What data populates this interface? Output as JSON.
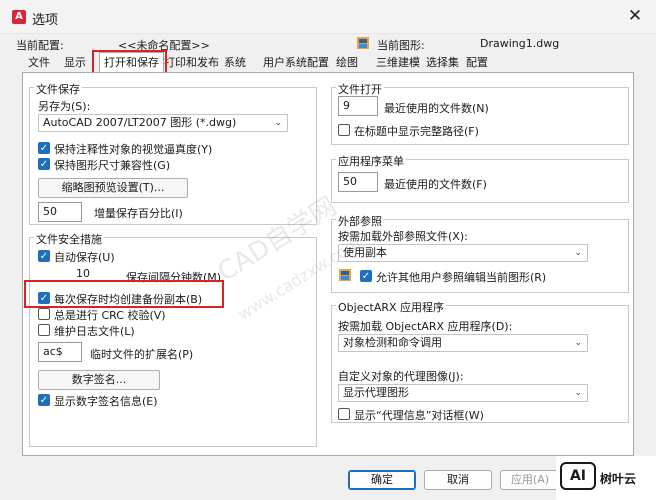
{
  "window": {
    "title": "选项",
    "app_icon_letter": "A",
    "close_glyph": "✕"
  },
  "profile": {
    "current_profile_label": "当前配置:",
    "current_profile_value": "<<未命名配置>>",
    "current_drawing_label": "当前图形:",
    "current_drawing_value": "Drawing1.dwg"
  },
  "tabs": [
    "文件",
    "显示",
    "打开和保存",
    "打印和发布",
    "系统",
    "用户系统配置",
    "绘图",
    "三维建模",
    "选择集",
    "配置"
  ],
  "active_tab": "打开和保存",
  "file_save": {
    "title": "文件保存",
    "save_as_label": "另存为(S):",
    "save_as_value": "AutoCAD 2007/LT2007 图形 (*.dwg)",
    "keep_visual_fidelity": "保持注释性对象的视觉逼真度(Y)",
    "keep_drawing_size": "保持图形尺寸兼容性(G)",
    "thumbnail_button": "缩略图预览设置(T)...",
    "incremental_value": "50",
    "incremental_label": "增量保存百分比(I)"
  },
  "file_safety": {
    "title": "文件安全措施",
    "autosave": "自动保存(U)",
    "autosave_minutes_value": "10",
    "autosave_minutes_label": "保存间隔分钟数(M)",
    "backup_copy": "每次保存时均创建备份副本(B)",
    "crc": "总是进行 CRC 校验(V)",
    "log_file": "维护日志文件(L)",
    "temp_ext_value": "ac$",
    "temp_ext_label": "临时文件的扩展名(P)",
    "digital_sig_button": "数字签名...",
    "show_sig_info": "显示数字签名信息(E)"
  },
  "file_open": {
    "title": "文件打开",
    "recent_value": "9",
    "recent_label": "最近使用的文件数(N)",
    "full_path": "在标题中显示完整路径(F)"
  },
  "app_menu": {
    "title": "应用程序菜单",
    "recent_value": "50",
    "recent_label": "最近使用的文件数(F)"
  },
  "xrefs": {
    "title": "外部参照",
    "demand_load_label": "按需加载外部参照文件(X):",
    "demand_load_value": "使用副本",
    "allow_edit": "允许其他用户参照编辑当前图形(R)"
  },
  "objectarx": {
    "title": "ObjectARX 应用程序",
    "demand_load_label": "按需加载 ObjectARX 应用程序(D):",
    "demand_load_value": "对象检测和命令调用",
    "proxy_images_label": "自定义对象的代理图像(J):",
    "proxy_images_value": "显示代理图形",
    "proxy_dialog": "显示“代理信息”对话框(W)"
  },
  "buttons": {
    "ok": "确定",
    "cancel": "取消",
    "apply": "应用(A)"
  },
  "logo": {
    "badge": "AI",
    "text": "树叶云"
  },
  "watermark": {
    "line1": "CAD自学网",
    "line2": "www.cadzxw.com"
  },
  "check_glyph": "✓",
  "chevron_glyph": "⌄",
  "colors": {
    "accent": "#1f6fbf",
    "highlight_red": "#e02020",
    "app_icon": "#d8263a"
  }
}
